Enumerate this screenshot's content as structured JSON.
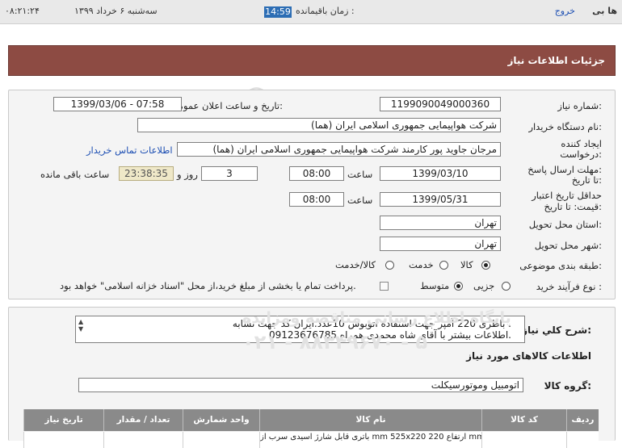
{
  "topbar": {
    "user": "ها بی",
    "logout": "خروج",
    "remaining_label": "زمان باقیمانده :",
    "remaining_value": "14:59",
    "date": "سه‌شنبه ۶ خرداد ۱۳۹۹",
    "clock": "۰۸:۲۱:۲۴"
  },
  "banner": {
    "title": "جزئیات اطلاعات نیاز"
  },
  "form": {
    "need_number_label": "شماره نیاز:",
    "need_number": "1199090049000360",
    "announce_label": "تاریخ و ساعت اعلان عمومی:",
    "announce_value": "1399/03/06 - 07:58",
    "buyer_label": "نام دستگاه خریدار:",
    "buyer_value": "شرکت هواپیمایی جمهوری اسلامی ایران (هما)",
    "creator_label_1": "ایجاد کننده",
    "creator_label_2": "درخواست:",
    "creator_value": "مرجان جاوید پور کارمند شرکت هواپیمایی جمهوری اسلامی ایران (هما)",
    "contact_link": "اطلاعات تماس خریدار",
    "deadline_label_1": "مهلت ارسال پاسخ:",
    "deadline_label_2": "تا تاریخ:",
    "deadline_date": "1399/03/10",
    "time_label": "ساعت",
    "deadline_time": "08:00",
    "days_value": "3",
    "days_label": "روز و",
    "remaining_time": "23:38:35",
    "remaining_label": "ساعت باقی مانده",
    "validity_label_1": "حداقل تاریخ اعتبار",
    "validity_label_2": "قیمت: تا تاریخ:",
    "validity_date": "1399/05/31",
    "validity_time_label": "ساعت",
    "validity_time": "08:00",
    "province_label": "استان محل تحویل:",
    "province_value": "تهران",
    "city_label": "شهر محل تحویل:",
    "city_value": "تهران",
    "category_label": "طبقه بندی موضوعی:",
    "category_options": [
      "کالا",
      "خدمت",
      "کالا/خدمت"
    ],
    "category_selected": "کالا",
    "process_label": "نوع فرآیند خرید :",
    "process_options": [
      "جزیی",
      "متوسط"
    ],
    "process_selected": "متوسط",
    "treasury_note": "پرداخت تمام یا بخشی از مبلغ خرید،از محل \"اسناد خزانه اسلامی\" خواهد بود."
  },
  "description": {
    "label": "شرح کلي نياز:",
    "line1": "باطری 220 آمپر جهت استفاده اتوبوس 10عدد.ایران کد جهت تشابه .",
    "line2": "اطلاعات بیشتر با آقای شاه محمدی همراه 09123676785."
  },
  "goods": {
    "section_title": "اطلاعات کالاهای مورد نیاز",
    "group_label": "گروه کالا:",
    "group_value": "اتومبیل وموتورسیکلت"
  },
  "table": {
    "headers": [
      "ردیف",
      "کد کالا",
      "نام کالا",
      "واحد شمارش",
      "تعداد / مقدار",
      "تاریخ نیاز"
    ],
    "row1_name": "باتری قابل شارژ اسیدی سرب از mm 525x220 ارتفاع 220 mm"
  },
  "watermark": {
    "brand": "ParsNamadData",
    "tagline": "پایگاه اطلاع رسانی مناقصه ومزایده",
    "phone": "۰۲۱ - ۸۸۳۴۹۶۷۰ - ۵"
  },
  "colors": {
    "banner": "#8d4b43",
    "timer_badge": "#2c6db4",
    "table_header": "#8a8a8a",
    "link": "#1d4fb3"
  }
}
